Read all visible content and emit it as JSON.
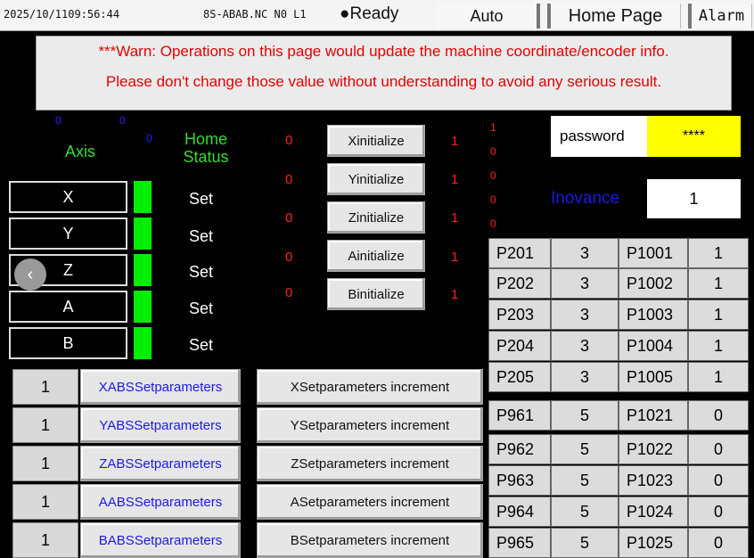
{
  "topbar": {
    "datetime": "2025/10/1109:56:44",
    "program": "8S-ABAB.NC N0 L1",
    "status": "●Ready",
    "mode": "Auto",
    "home_tab": "Home Page",
    "alarm_tab": "Alarm"
  },
  "warning": {
    "line1": "***Warn: Operations on this page would update the machine coordinate/encoder info.",
    "line2": "Please don't change those value without understanding to avoid any serious result."
  },
  "header": {
    "axis_label": "Axis",
    "home_status_label": "Home\nStatus",
    "small_zero_1": "0",
    "small_zero_2": "0",
    "small_zero_3": "0"
  },
  "axes": [
    {
      "name": "X",
      "status": "Set"
    },
    {
      "name": "Y",
      "status": "Set"
    },
    {
      "name": "Z",
      "status": "Set"
    },
    {
      "name": "A",
      "status": "Set"
    },
    {
      "name": "B",
      "status": "Set"
    }
  ],
  "init": [
    {
      "left": "0",
      "label": "Xinitialize",
      "right": "1"
    },
    {
      "left": "0",
      "label": "Yinitialize",
      "right": "1"
    },
    {
      "left": "0",
      "label": "Zinitialize",
      "right": "1"
    },
    {
      "left": "0",
      "label": "Ainitialize",
      "right": "1"
    },
    {
      "left": "0",
      "label": "Binitialize",
      "right": "1"
    }
  ],
  "red_column": [
    "1",
    "0",
    "0",
    "0",
    "0"
  ],
  "password": {
    "label": "password",
    "value": "****"
  },
  "inovance": {
    "label": "Inovance",
    "value": "1"
  },
  "abs_rows": [
    {
      "value": "1",
      "abs_label": "XABSSetparameters",
      "inc_label": "XSetparameters increment"
    },
    {
      "value": "1",
      "abs_label": "YABSSetparameters",
      "inc_label": "YSetparameters increment"
    },
    {
      "value": "1",
      "abs_label": "ZABSSetparameters",
      "inc_label": "ZSetparameters increment"
    },
    {
      "value": "1",
      "abs_label": "AABSSetparameters",
      "inc_label": "ASetparameters increment"
    },
    {
      "value": "1",
      "abs_label": "BABSSetparameters",
      "inc_label": "BSetparameters increment"
    }
  ],
  "param_table": [
    [
      "P201",
      "3",
      "P1001",
      "1"
    ],
    [
      "P202",
      "3",
      "P1002",
      "1"
    ],
    [
      "P203",
      "3",
      "P1003",
      "1"
    ],
    [
      "P204",
      "3",
      "P1004",
      "1"
    ],
    [
      "P205",
      "3",
      "P1005",
      "1"
    ],
    [
      "P961",
      "5",
      "P1021",
      "0"
    ],
    [
      "P962",
      "5",
      "P1022",
      "0"
    ],
    [
      "P963",
      "5",
      "P1023",
      "0"
    ],
    [
      "P964",
      "5",
      "P1024",
      "0"
    ],
    [
      "P965",
      "5",
      "P1025",
      "0"
    ]
  ],
  "colors": {
    "accent_green": "#00ee00",
    "warn_red": "#e60000",
    "password_bg": "#ffff00",
    "inovance_blue": "#1a1ae6"
  }
}
